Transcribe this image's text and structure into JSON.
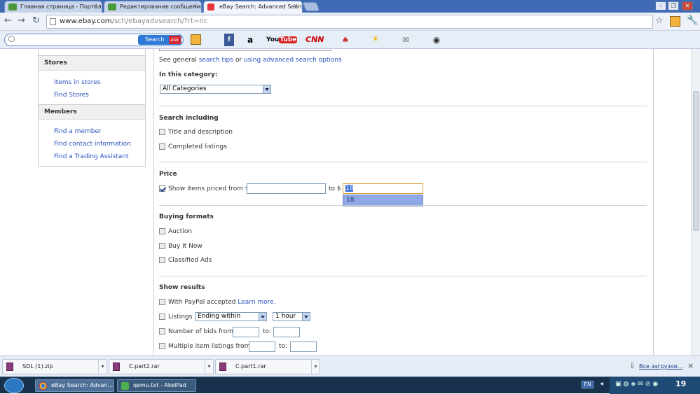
{
  "browser": {
    "tabs": [
      {
        "title": "Главная страница - Портал",
        "active": false
      },
      {
        "title": "Редактирование сообщения",
        "active": false
      },
      {
        "title": "eBay Search: Advanced Searc",
        "active": true
      }
    ],
    "tab_close": "×",
    "url_host": "www.ebay.com",
    "url_path": "/sch/ebayadvsearch/?rt=nc"
  },
  "toolbar": {
    "search_placeholder": "",
    "search_button": "Search",
    "ask_logo": "Ask",
    "youtube": "YouTube",
    "cnn": "CNN"
  },
  "sidebar": {
    "stores_header": "Stores",
    "stores_links": [
      "Items in stores",
      "Find Stores"
    ],
    "members_header": "Members",
    "members_links": [
      "Find a member",
      "Find contact information",
      "Find a Trading Assistant"
    ]
  },
  "main": {
    "tips_prefix": "See general",
    "tips_link1": "search tips",
    "tips_or": "or",
    "tips_link2": "using advanced search options",
    "category_label": "In this category:",
    "category_value": "All Categories",
    "search_including_header": "Search including",
    "search_including_options": [
      {
        "label": "Title and description",
        "checked": false
      },
      {
        "label": "Completed listings",
        "checked": false
      }
    ],
    "price_header": "Price",
    "price_option_label": "Show items priced from $",
    "price_option_checked": true,
    "price_from_value": "",
    "price_to_label": "to $",
    "price_to_value": "18",
    "autocomplete_suggestion": "18",
    "buying_formats_header": "Buying formats",
    "buying_formats_options": [
      {
        "label": "Auction",
        "checked": false
      },
      {
        "label": "Buy It Now",
        "checked": false
      },
      {
        "label": "Classified Ads",
        "checked": false
      }
    ],
    "show_results_header": "Show results",
    "paypal_label": "With PayPal accepted",
    "learn_more": "Learn more.",
    "listings_label": "Listings",
    "listings_select": "Ending within",
    "listings_time": "1 hour",
    "bids_label": "Number of bids from:",
    "bids_to": "to:",
    "multiple_label": "Multiple item listings from:",
    "multiple_to": "to:"
  },
  "downloads": {
    "items": [
      "SDL (1).zip",
      "C.part2.rar",
      "C.part1.rar"
    ],
    "show_all": "Все загрузки...",
    "close": "×"
  },
  "taskbar": {
    "tasks": [
      "eBay Search: Advan...",
      "qemu.txt - AkelPad"
    ],
    "lang": "EN",
    "clock": "19"
  }
}
